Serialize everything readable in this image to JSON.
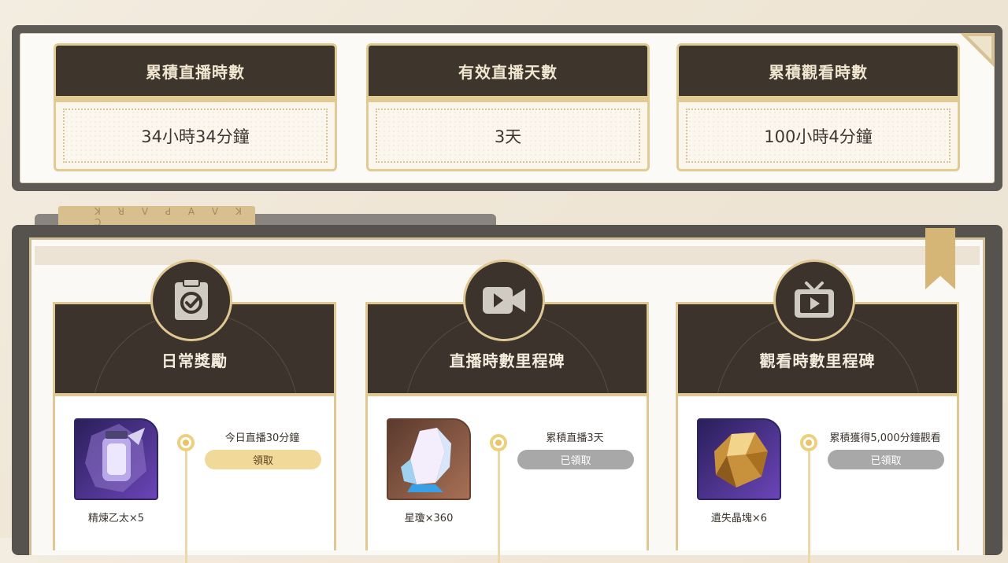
{
  "stats": [
    {
      "label": "累積直播時數",
      "value": "34小時34分鐘"
    },
    {
      "label": "有效直播天數",
      "value": "3天"
    },
    {
      "label": "累積觀看時數",
      "value": "100小時4分鐘"
    }
  ],
  "section_tab": {
    "label": "ꓘ ꓤ ꓦ ꓒ   ꓮ ꓦ ꓘ ꓛ"
  },
  "columns": [
    {
      "title": "日常獎勵",
      "icon": "clipboard-check-icon",
      "item_name": "精煉乙太×5",
      "condition": "今日直播30分鐘",
      "button_label": "領取",
      "button_state": "active"
    },
    {
      "title": "直播時數里程碑",
      "icon": "video-camera-icon",
      "item_name": "星瓊×360",
      "condition": "累積直播3天",
      "button_label": "已領取",
      "button_state": "done"
    },
    {
      "title": "觀看時數里程碑",
      "icon": "tv-play-icon",
      "item_name": "遺失晶塊×6",
      "condition": "累積獲得5,000分鐘觀看",
      "button_label": "已領取",
      "button_state": "done"
    }
  ],
  "colors": {
    "frame_dark": "#5e5a55",
    "header_dark": "#3e352d",
    "gold": "#e2ca93",
    "claim_active": "#f1d99a",
    "claimed_grey": "#a8a8a8"
  }
}
